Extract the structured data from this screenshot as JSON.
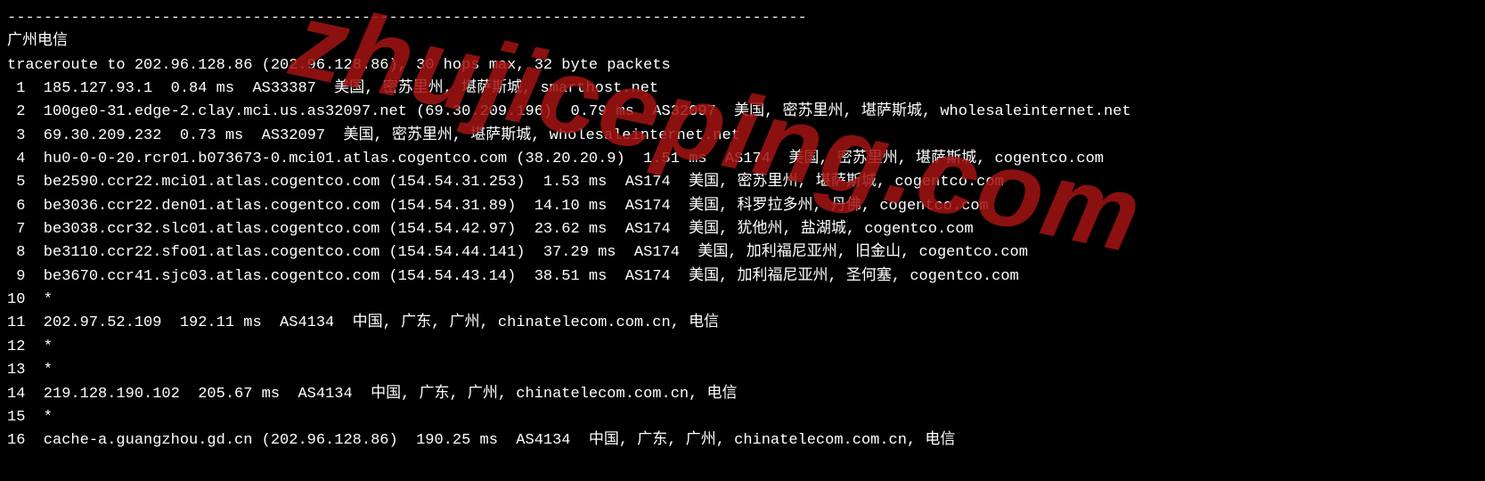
{
  "separator": "----------------------------------------------------------------------------------------",
  "header": "广州电信",
  "command": "traceroute to 202.96.128.86 (202.96.128.86), 30 hops max, 32 byte packets",
  "watermark": "zhujiceping.com",
  "hops": [
    {
      "n": 1,
      "host": "185.127.93.1",
      "ip": "",
      "ms": "0.84 ms",
      "asn": "AS33387",
      "loc": "美国, 密苏里州, 堪萨斯城, smarthost.net"
    },
    {
      "n": 2,
      "host": "100ge0-31.edge-2.clay.mci.us.as32097.net",
      "ip": "(69.30.209.196)",
      "ms": "0.79 ms",
      "asn": "AS32097",
      "loc": "美国, 密苏里州, 堪萨斯城, wholesaleinternet.net"
    },
    {
      "n": 3,
      "host": "69.30.209.232",
      "ip": "",
      "ms": "0.73 ms",
      "asn": "AS32097",
      "loc": "美国, 密苏里州, 堪萨斯城, wholesaleinternet.net"
    },
    {
      "n": 4,
      "host": "hu0-0-0-20.rcr01.b073673-0.mci01.atlas.cogentco.com",
      "ip": "(38.20.20.9)",
      "ms": "1.51 ms",
      "asn": "AS174",
      "loc": "美国, 密苏里州, 堪萨斯城, cogentco.com"
    },
    {
      "n": 5,
      "host": "be2590.ccr22.mci01.atlas.cogentco.com",
      "ip": "(154.54.31.253)",
      "ms": "1.53 ms",
      "asn": "AS174",
      "loc": "美国, 密苏里州, 堪萨斯城, cogentco.com"
    },
    {
      "n": 6,
      "host": "be3036.ccr22.den01.atlas.cogentco.com",
      "ip": "(154.54.31.89)",
      "ms": "14.10 ms",
      "asn": "AS174",
      "loc": "美国, 科罗拉多州, 丹佛, cogentco.com"
    },
    {
      "n": 7,
      "host": "be3038.ccr32.slc01.atlas.cogentco.com",
      "ip": "(154.54.42.97)",
      "ms": "23.62 ms",
      "asn": "AS174",
      "loc": "美国, 犹他州, 盐湖城, cogentco.com"
    },
    {
      "n": 8,
      "host": "be3110.ccr22.sfo01.atlas.cogentco.com",
      "ip": "(154.54.44.141)",
      "ms": "37.29 ms",
      "asn": "AS174",
      "loc": "美国, 加利福尼亚州, 旧金山, cogentco.com"
    },
    {
      "n": 9,
      "host": "be3670.ccr41.sjc03.atlas.cogentco.com",
      "ip": "(154.54.43.14)",
      "ms": "38.51 ms",
      "asn": "AS174",
      "loc": "美国, 加利福尼亚州, 圣何塞, cogentco.com"
    },
    {
      "n": 10,
      "host": "*",
      "ip": "",
      "ms": "",
      "asn": "",
      "loc": ""
    },
    {
      "n": 11,
      "host": "202.97.52.109",
      "ip": "",
      "ms": "192.11 ms",
      "asn": "AS4134",
      "loc": "中国, 广东, 广州, chinatelecom.com.cn, 电信"
    },
    {
      "n": 12,
      "host": "*",
      "ip": "",
      "ms": "",
      "asn": "",
      "loc": ""
    },
    {
      "n": 13,
      "host": "*",
      "ip": "",
      "ms": "",
      "asn": "",
      "loc": ""
    },
    {
      "n": 14,
      "host": "219.128.190.102",
      "ip": "",
      "ms": "205.67 ms",
      "asn": "AS4134",
      "loc": "中国, 广东, 广州, chinatelecom.com.cn, 电信"
    },
    {
      "n": 15,
      "host": "*",
      "ip": "",
      "ms": "",
      "asn": "",
      "loc": ""
    },
    {
      "n": 16,
      "host": "cache-a.guangzhou.gd.cn",
      "ip": "(202.96.128.86)",
      "ms": "190.25 ms",
      "asn": "AS4134",
      "loc": "中国, 广东, 广州, chinatelecom.com.cn, 电信"
    }
  ]
}
